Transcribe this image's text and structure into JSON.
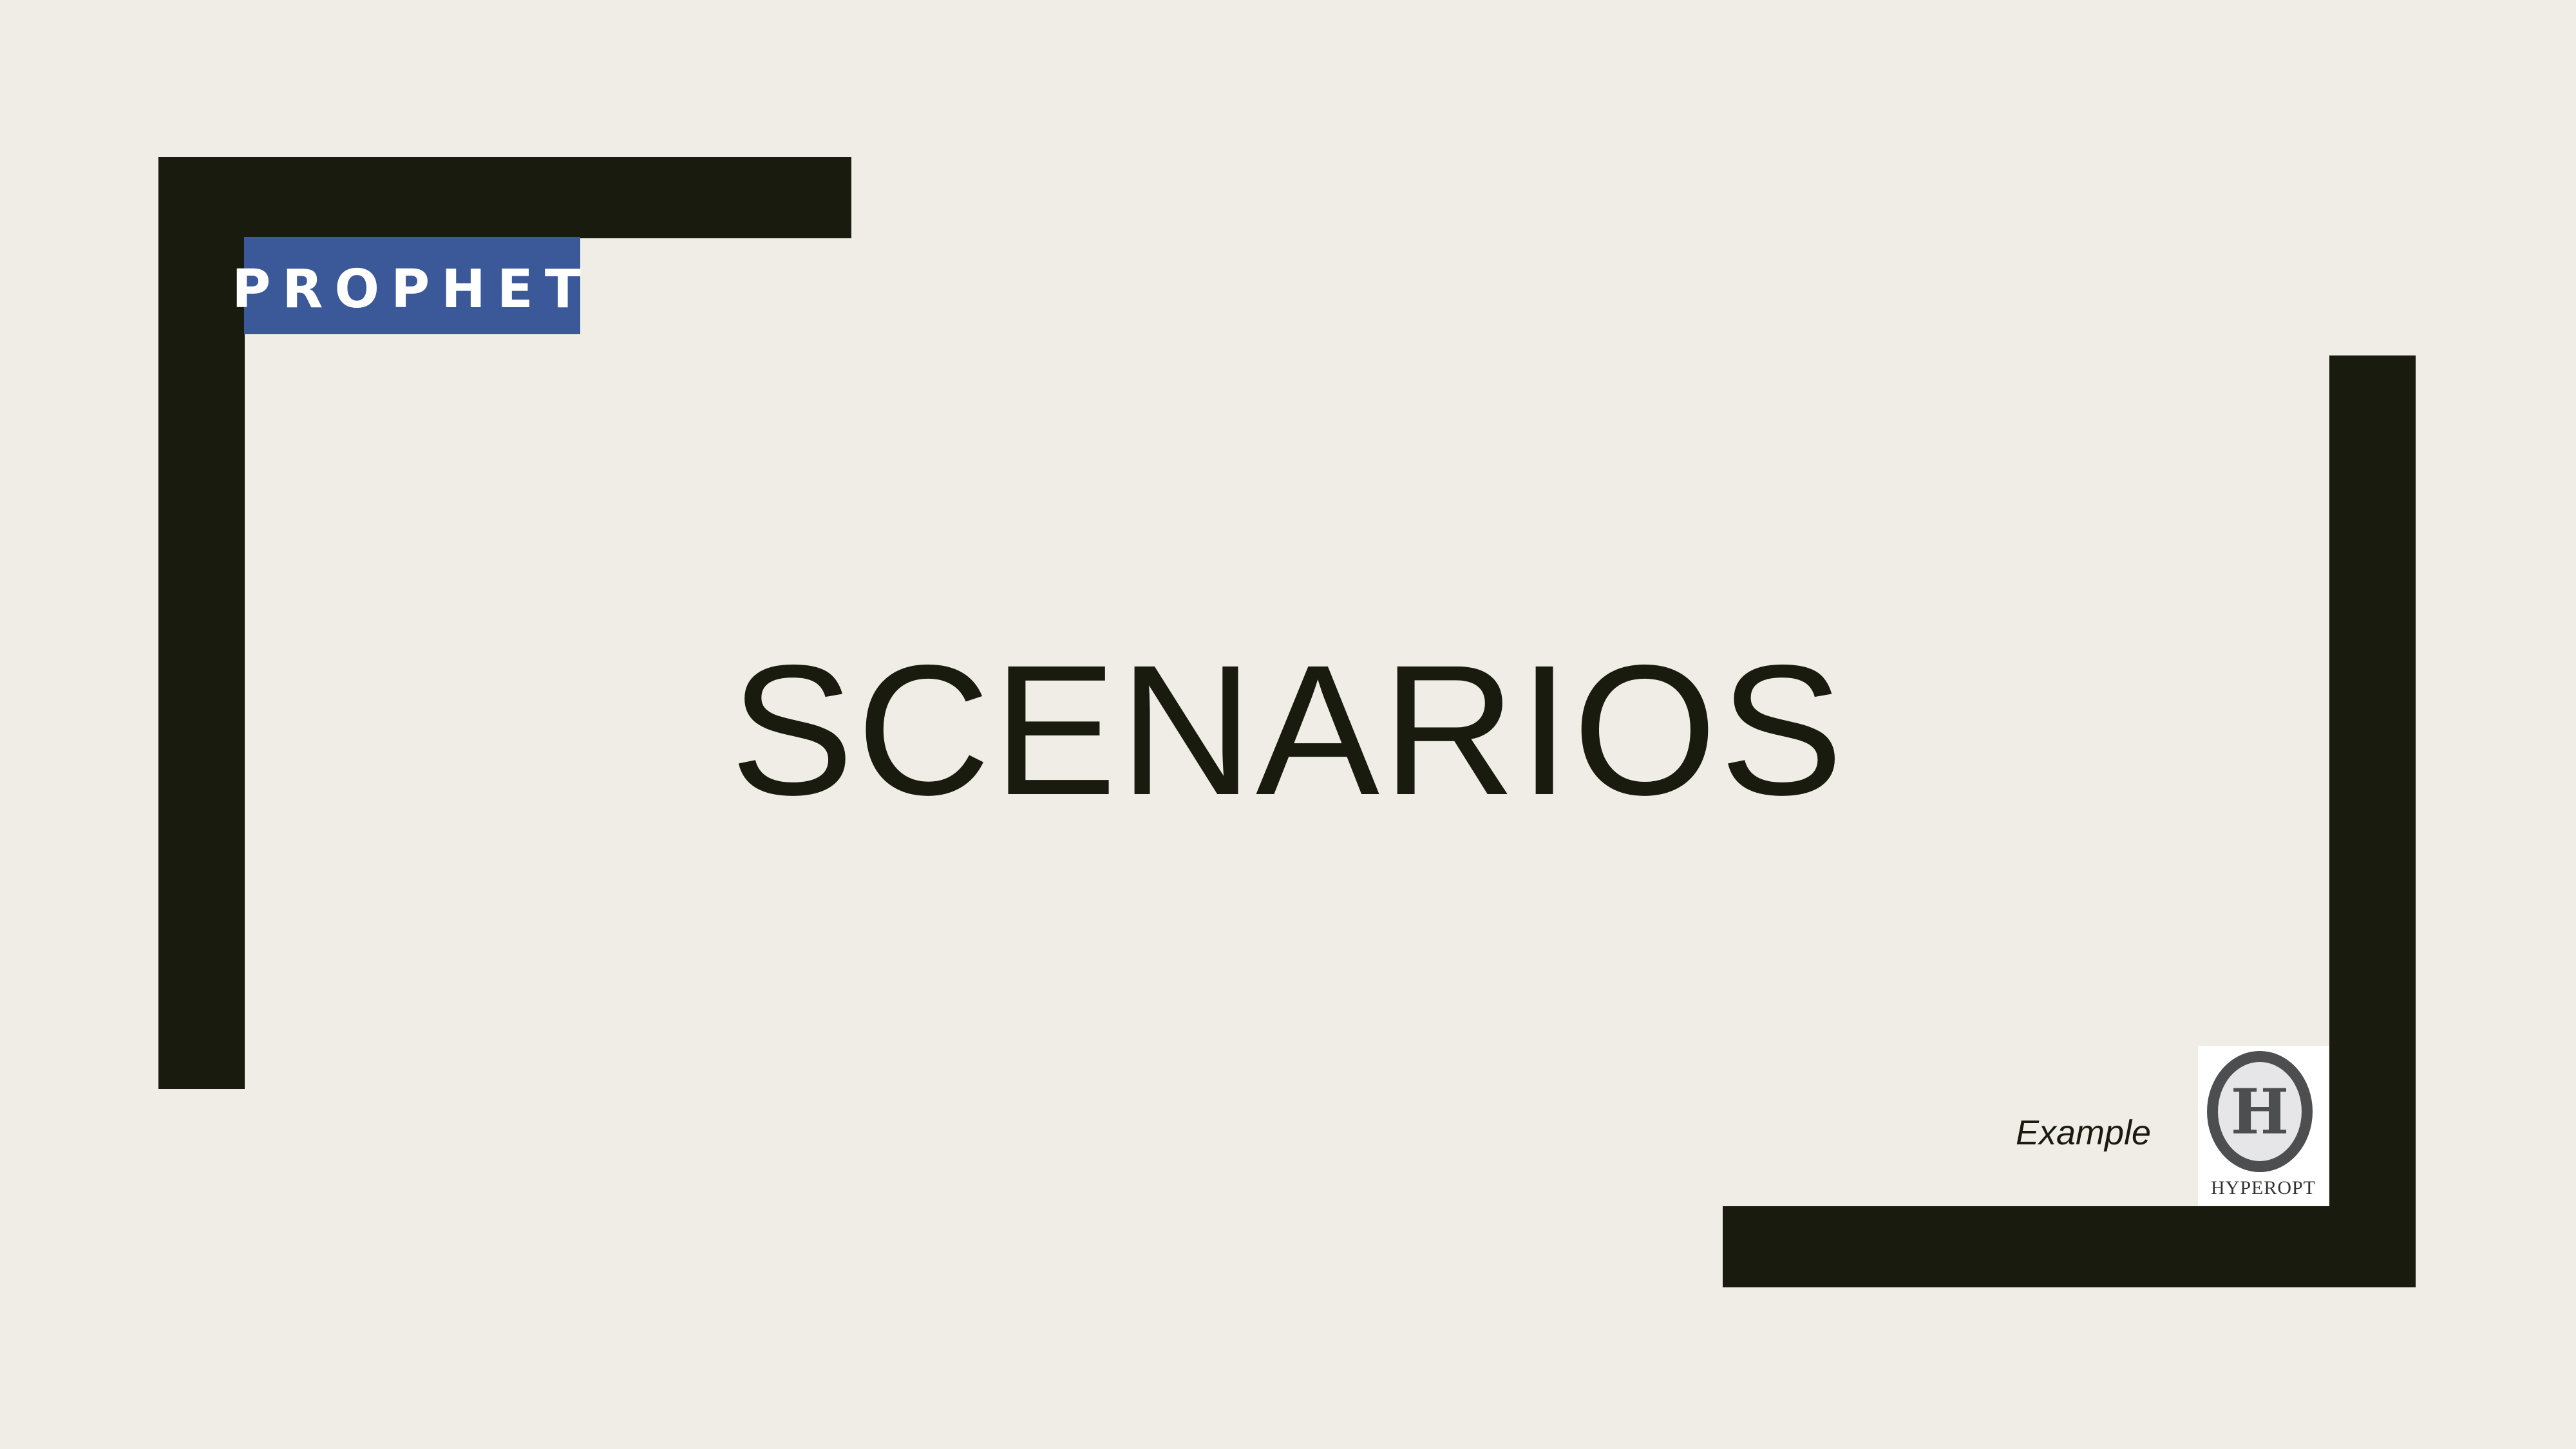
{
  "slide": {
    "title": "SCENARIOS",
    "example_label": "Example",
    "background_color": "#efede5",
    "accent_color": "#1a1b0f"
  },
  "logos": {
    "prophet": {
      "text": "PROPHET",
      "background_color": "#3b5898"
    },
    "hyperopt": {
      "letter": "H",
      "text": "HYPEROPT"
    }
  }
}
